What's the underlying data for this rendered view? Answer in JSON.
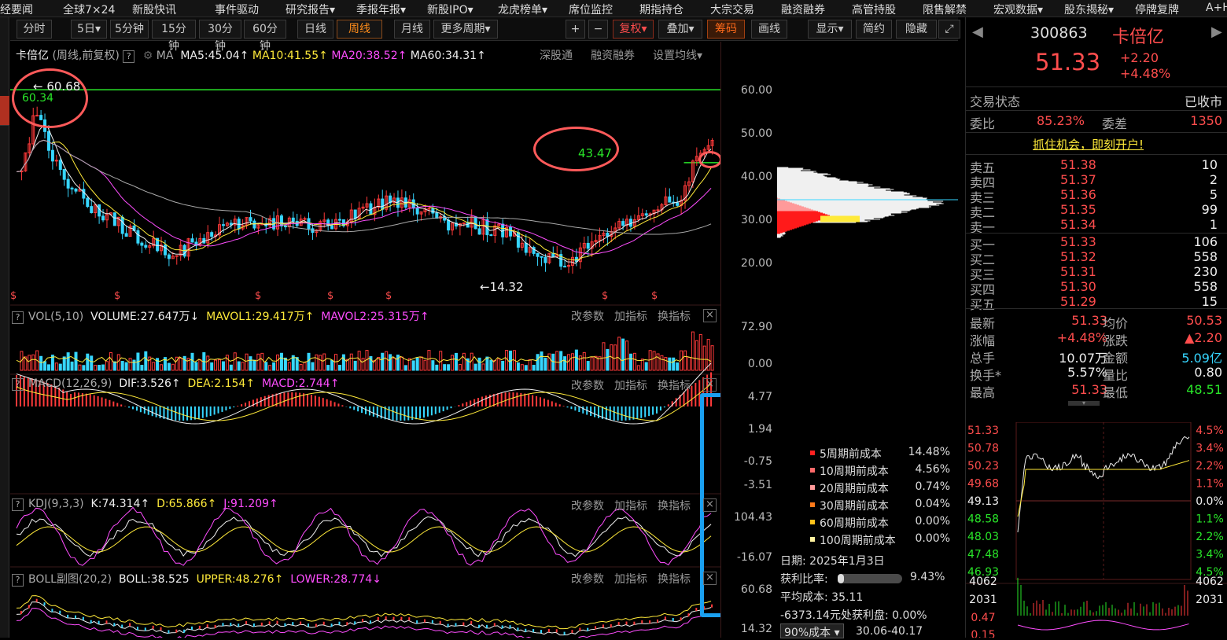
{
  "topnav": {
    "items": [
      "经要闻",
      "全球7×24",
      "新股快讯",
      "事件驱动",
      "研究报告▾",
      "季报年报▾",
      "新股IPO▾",
      "龙虎榜单▾",
      "席位监控",
      "期指持仓",
      "大宗交易",
      "融资融券",
      "高管持股",
      "限售解禁",
      "宏观数据▾",
      "股东揭秘▾",
      "停牌复牌",
      "A+H"
    ]
  },
  "periodbar": {
    "items": [
      "分时",
      "5日▾",
      "5分钟",
      "15分钟",
      "30分钟",
      "60分钟",
      "日线",
      "周线",
      "月线",
      "更多周期▾"
    ],
    "selected": "周线",
    "right": [
      "+",
      "−",
      "复权▾",
      "叠加▾",
      "筹码",
      "画线",
      "显示▾",
      "简约",
      "隐藏▸▸",
      "⤢"
    ]
  },
  "main": {
    "name": "卡倍亿",
    "mode": "(周线,前复权)",
    "ma_label": "MA",
    "ma5": "MA5:45.04",
    "ma10": "MA10:41.55",
    "ma20": "MA20:38.52",
    "ma60": "MA60:34.31",
    "links": [
      "深股通",
      "融资融券",
      "设置均线▾"
    ],
    "marks": {
      "high": "← 60.68",
      "high_line": "60.34",
      "mid": "43.47",
      "low": "←14.32"
    },
    "axis": [
      "60.00",
      "50.00",
      "40.00",
      "30.00",
      "20.00"
    ],
    "dividend_mark": "$"
  },
  "vol": {
    "label": "VOL(5,10)",
    "volume": "VOLUME:27.647万",
    "mavol1": "MAVOL1:29.417万",
    "mavol2": "MAVOL2:25.315万",
    "axis": [
      "72.90",
      "0.00"
    ]
  },
  "macd": {
    "label": "MACD(12,26,9)",
    "dif": "DIF:3.526",
    "dea": "DEA:2.154",
    "macd": "MACD:2.744",
    "axis": [
      "4.77",
      "1.94",
      "-0.75",
      "-3.51"
    ]
  },
  "kdj": {
    "label": "KDJ(9,3,3)",
    "k": "K:74.314",
    "d": "D:65.866",
    "j": "J:91.209",
    "axis": [
      "104.43",
      "-16.07"
    ]
  },
  "boll": {
    "label": "BOLL副图(20,2)",
    "boll": "BOLL:38.525",
    "upper": "UPPER:48.276",
    "lower": "LOWER:28.774",
    "axis": [
      "60.68",
      "14.32"
    ]
  },
  "panel_tools": [
    "改参数",
    "加指标",
    "换指标"
  ],
  "chip": {
    "cost": [
      {
        "label": "5周期前成本",
        "pct": "14.48%",
        "color": "#ff2020"
      },
      {
        "label": "10周期前成本",
        "pct": "4.56%",
        "color": "#ff6a6a"
      },
      {
        "label": "20周期前成本",
        "pct": "0.74%",
        "color": "#ff9a9a"
      },
      {
        "label": "30周期前成本",
        "pct": "0.04%",
        "color": "#ff7a1a"
      },
      {
        "label": "60周期前成本",
        "pct": "0.00%",
        "color": "#ffc21a"
      },
      {
        "label": "100周期前成本",
        "pct": "0.00%",
        "color": "#fff3a0"
      }
    ],
    "date": "日期: 2025年1月3日",
    "profit_label": "获利比率:",
    "profit": "9.43%",
    "avg": "平均成本: 35.11",
    "profit_disk": "-6373.14元处获利盘: 0.00%",
    "cost_select": "90%成本 ▾",
    "range": "30.06-40.17"
  },
  "quote": {
    "code": "300863",
    "name": "卡倍亿",
    "price": "51.33",
    "chg": "+2.20",
    "pct": "+4.48%",
    "status_label": "交易状态",
    "status": "已收市",
    "wb_label": "委比",
    "wb": "85.23%",
    "wc_label": "委差",
    "wc": "1350",
    "promo": "抓住机会，即刻开户!",
    "asks": [
      {
        "l": "卖五",
        "p": "51.38",
        "v": "10"
      },
      {
        "l": "卖四",
        "p": "51.37",
        "v": "2"
      },
      {
        "l": "卖三",
        "p": "51.36",
        "v": "5"
      },
      {
        "l": "卖二",
        "p": "51.35",
        "v": "99"
      },
      {
        "l": "卖一",
        "p": "51.34",
        "v": "1"
      }
    ],
    "bids": [
      {
        "l": "买一",
        "p": "51.33",
        "v": "106"
      },
      {
        "l": "买二",
        "p": "51.32",
        "v": "558"
      },
      {
        "l": "买三",
        "p": "51.31",
        "v": "230"
      },
      {
        "l": "买四",
        "p": "51.30",
        "v": "558"
      },
      {
        "l": "买五",
        "p": "51.29",
        "v": "15"
      }
    ],
    "stats": [
      [
        "最新",
        "51.33",
        "均价",
        "50.53"
      ],
      [
        "涨幅",
        "+4.48%",
        "涨跌",
        "▲2.20"
      ],
      [
        "总手",
        "10.07万",
        "金额",
        "5.09亿"
      ],
      [
        "换手*",
        "5.57%",
        "量比",
        "0.80"
      ],
      [
        "最高",
        "51.33",
        "最低",
        "48.51"
      ]
    ],
    "mini_left": [
      "51.33",
      "50.78",
      "50.23",
      "49.68",
      "49.13",
      "48.58",
      "48.03",
      "47.48",
      "46.93"
    ],
    "mini_right": [
      "4.5%",
      "3.4%",
      "2.2%",
      "1.1%",
      "0.0%",
      "1.1%",
      "2.2%",
      "3.4%",
      "4.5%"
    ],
    "mini_vol": [
      "4062",
      "2031",
      "0.47",
      "0.15"
    ],
    "mini_vol_r": [
      "4062",
      "2031"
    ]
  }
}
